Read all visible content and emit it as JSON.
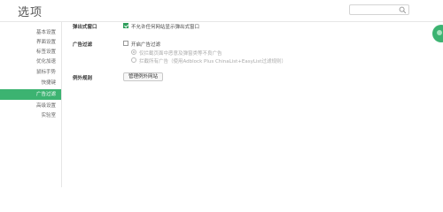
{
  "window": {
    "title": "选项"
  },
  "search": {
    "placeholder": "",
    "icon": "search-icon"
  },
  "sidebar": {
    "items": [
      {
        "label": "基本设置",
        "active": false
      },
      {
        "label": "界面设置",
        "active": false
      },
      {
        "label": "标签设置",
        "active": false
      },
      {
        "label": "优化加速",
        "active": false
      },
      {
        "label": "鼠标手势",
        "active": false
      },
      {
        "label": "快捷键",
        "active": false
      },
      {
        "label": "广告过滤",
        "active": true
      },
      {
        "label": "高级设置",
        "active": false
      },
      {
        "label": "实验室",
        "active": false
      }
    ],
    "active_color": "#3cb371"
  },
  "popup_section": {
    "label": "弹出式窗口",
    "checkbox_label": "不允许任何网站显示弹出式窗口",
    "checked": true
  },
  "ad_section": {
    "label": "广告过滤",
    "checkbox_label": "开启广告过滤",
    "checked": false,
    "options": [
      {
        "label": "仅拦截页面中恶意及弹窗类等不良广告",
        "selected": true
      },
      {
        "label": "拦截所有广告（使用Adblock Plus ChinaList+EasyList过滤规则）",
        "selected": false
      }
    ]
  },
  "exception_section": {
    "label": "例外规则",
    "button_label": "管理例外网站"
  }
}
